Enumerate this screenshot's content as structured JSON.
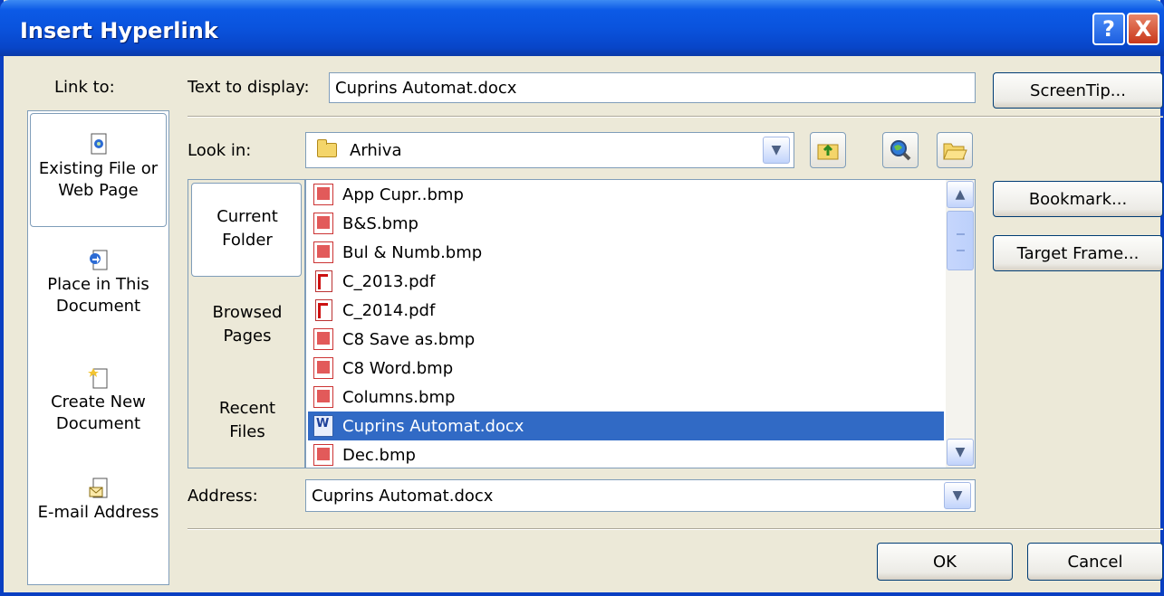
{
  "dialog": {
    "title": "Insert Hyperlink",
    "help_label": "?",
    "close_label": "X"
  },
  "link_to": {
    "label": "Link to:",
    "items": [
      {
        "line1": "Existing File or",
        "line2": "Web Page",
        "icon": "existing-file-icon",
        "selected": true
      },
      {
        "line1": "Place in This",
        "line2": "Document",
        "icon": "place-in-document-icon",
        "selected": false
      },
      {
        "line1": "Create New",
        "line2": "Document",
        "icon": "new-document-icon",
        "selected": false
      },
      {
        "line1": "E-mail Address",
        "line2": "",
        "icon": "email-icon",
        "selected": false
      }
    ]
  },
  "text_to_display": {
    "label": "Text to display:",
    "value": "Cuprins Automat.docx"
  },
  "buttons": {
    "screentip": "ScreenTip...",
    "bookmark": "Bookmark...",
    "target_frame": "Target Frame...",
    "ok": "OK",
    "cancel": "Cancel"
  },
  "look_in": {
    "label": "Look in:",
    "value": "Arhiva",
    "icon": "folder-icon"
  },
  "toolbar_icons": [
    "up-folder-icon",
    "browse-web-icon",
    "browse-file-icon"
  ],
  "tabs": [
    {
      "line1": "Current",
      "line2": "Folder",
      "selected": true
    },
    {
      "line1": "Browsed",
      "line2": "Pages",
      "selected": false
    },
    {
      "line1": "Recent",
      "line2": "Files",
      "selected": false
    }
  ],
  "files": [
    {
      "name": "App Cupr..bmp",
      "type": "bmp",
      "selected": false
    },
    {
      "name": "B&S.bmp",
      "type": "bmp",
      "selected": false
    },
    {
      "name": "Bul & Numb.bmp",
      "type": "bmp",
      "selected": false
    },
    {
      "name": "C_2013.pdf",
      "type": "pdf",
      "selected": false
    },
    {
      "name": "C_2014.pdf",
      "type": "pdf",
      "selected": false
    },
    {
      "name": "C8 Save as.bmp",
      "type": "bmp",
      "selected": false
    },
    {
      "name": "C8 Word.bmp",
      "type": "bmp",
      "selected": false
    },
    {
      "name": "Columns.bmp",
      "type": "bmp",
      "selected": false
    },
    {
      "name": "Cuprins Automat.docx",
      "type": "docx",
      "selected": true
    },
    {
      "name": "Dec.bmp",
      "type": "bmp",
      "selected": false
    }
  ],
  "address": {
    "label": "Address:",
    "value": "Cuprins Automat.docx"
  },
  "colors": {
    "title_bar": "#0a53dd",
    "dialog_bg": "#ece9d8",
    "selection": "#316ac5"
  }
}
